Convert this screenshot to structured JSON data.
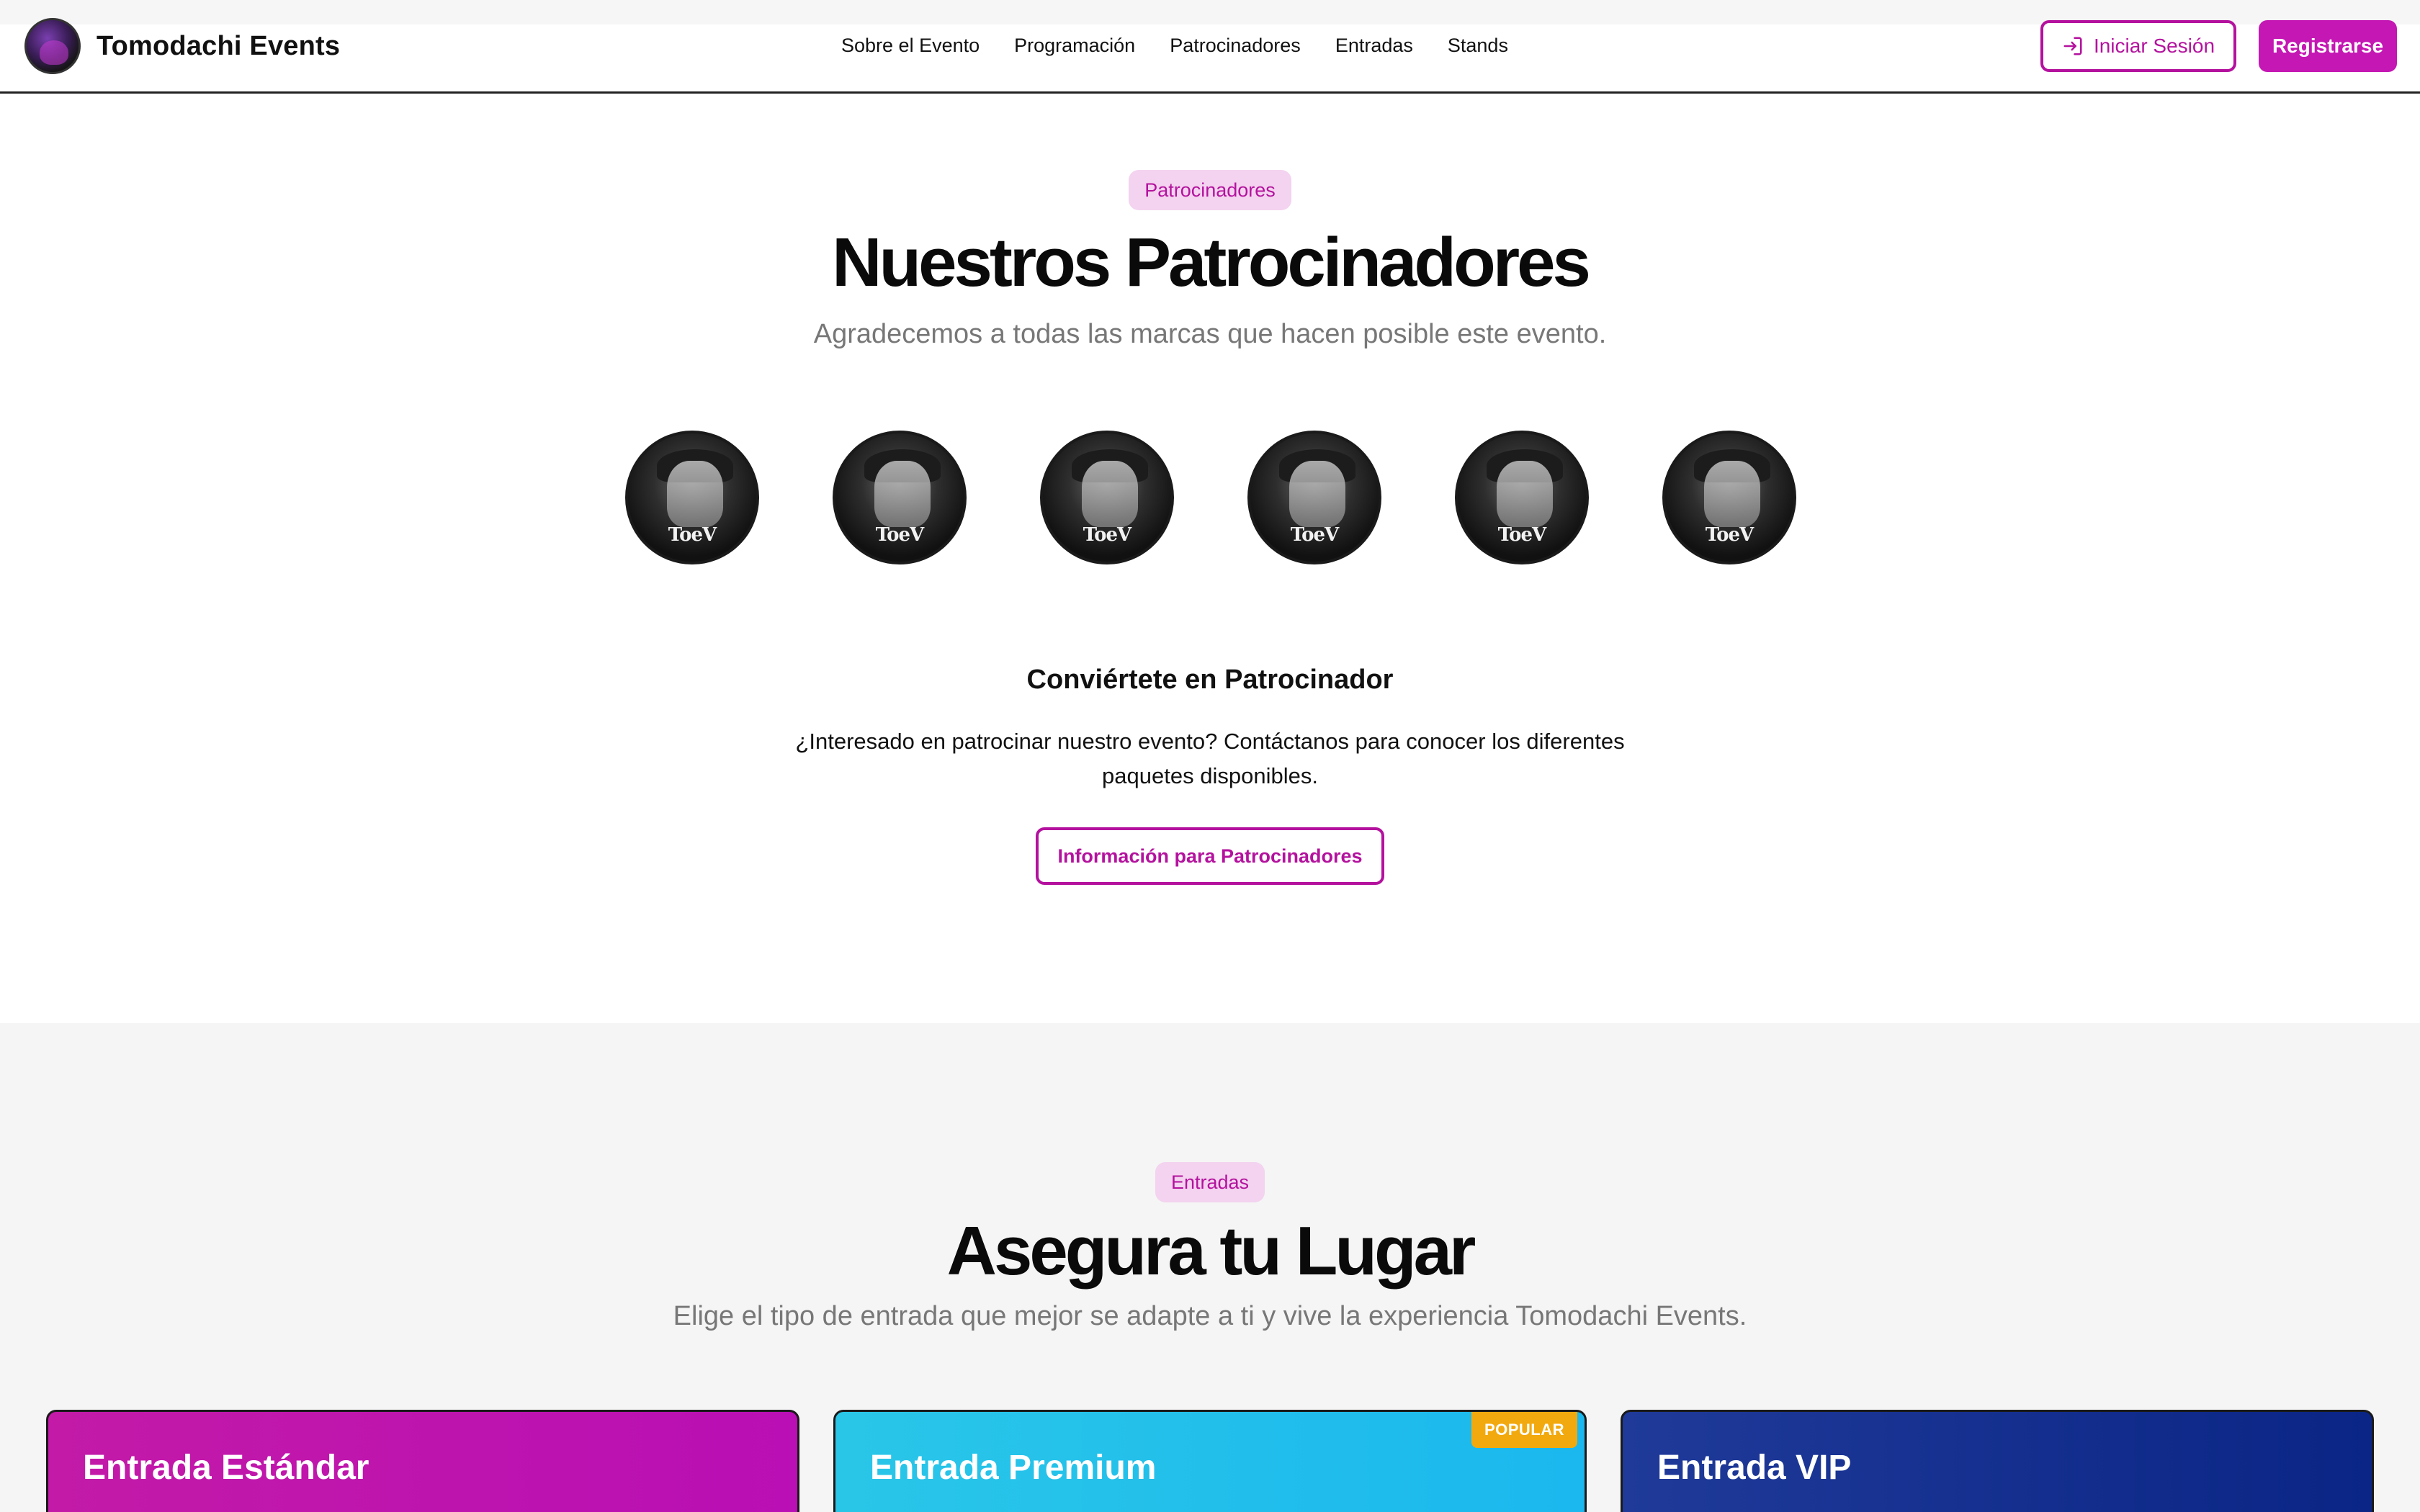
{
  "header": {
    "brand_name": "Tomodachi Events",
    "nav": [
      "Sobre el Evento",
      "Programación",
      "Patrocinadores",
      "Entradas",
      "Stands"
    ],
    "login_label": "Iniciar Sesión",
    "register_label": "Registrarse"
  },
  "sponsors": {
    "pill": "Patrocinadores",
    "title": "Nuestros Patrocinadores",
    "subtitle": "Agradecemos a todas las marcas que hacen posible este evento.",
    "logos": [
      "ToeV",
      "ToeV",
      "ToeV",
      "ToeV",
      "ToeV",
      "ToeV"
    ],
    "cta": {
      "title": "Conviértete en Patrocinador",
      "text_line1": "¿Interesado en patrocinar nuestro evento? Contáctanos para conocer los diferentes",
      "text_line2": "paquetes disponibles.",
      "button": "Información para Patrocinadores"
    }
  },
  "tickets": {
    "pill": "Entradas",
    "title": "Asegura tu Lugar",
    "subtitle": "Elige el tipo de entrada que mejor se adapte a ti y vive la experiencia Tomodachi Events.",
    "cards": [
      {
        "title": "Entrada Estándar",
        "badge": ""
      },
      {
        "title": "Entrada Premium",
        "badge": "POPULAR"
      },
      {
        "title": "Entrada VIP",
        "badge": ""
      }
    ]
  },
  "colors": {
    "accent": "#b4129e",
    "accent_fill": "#c417b3",
    "pill_bg": "#f3d3ef",
    "popular_badge": "#f2a90e"
  },
  "icons": {
    "login": "login-arrow-icon"
  }
}
